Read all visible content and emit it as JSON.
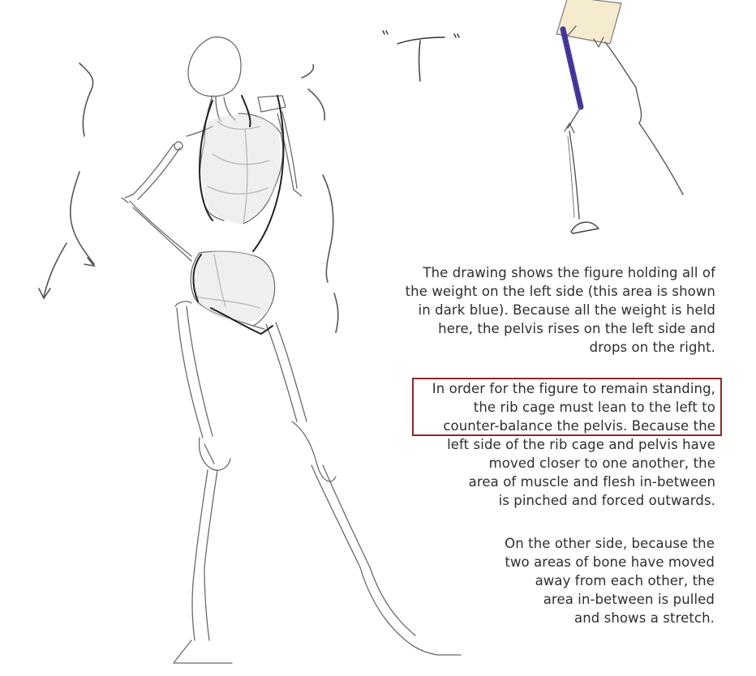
{
  "colors": {
    "weight_bar": "#4b3a9e",
    "pelvis_block": "#f5ecd0",
    "highlight_border": "#8a2a2a",
    "pencil": "#6a6a6a"
  },
  "paragraphs": [
    {
      "lines": [
        "The drawing shows the figure holding all of",
        "the weight on the left side (this area is shown",
        "in dark blue). Because all the weight is held",
        "here, the pelvis rises on the left side and",
        "drops on the right."
      ]
    },
    {
      "lines": [
        "In order for the figure to remain standing,",
        "the rib cage must lean to the left to",
        "counter-balance the pelvis. Because the",
        "left side of the rib cage and pelvis have",
        "moved closer to one another, the",
        "area of muscle and flesh in-between",
        "is pinched and forced outwards."
      ]
    },
    {
      "lines": [
        "On the other side, because the",
        "two areas of bone have moved",
        "away from each other, the",
        "area in-between is pulled",
        "and shows a stretch."
      ]
    }
  ]
}
